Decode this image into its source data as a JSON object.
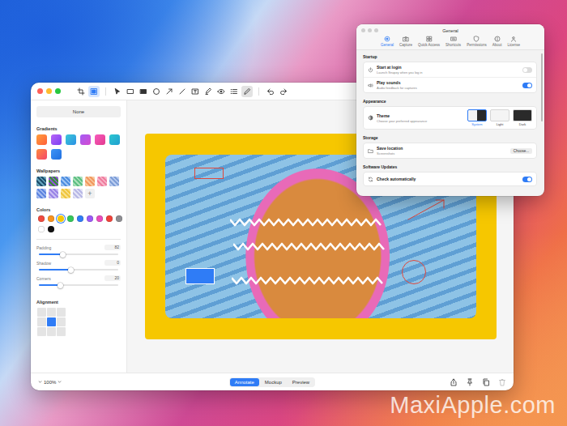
{
  "desktop": {
    "watermark": "MaxiApple.com"
  },
  "editor": {
    "toolbar": {
      "tools": [
        {
          "kind": "crop",
          "selected": false
        },
        {
          "kind": "background",
          "selected": true
        },
        {
          "kind": "select",
          "selected": false
        },
        {
          "kind": "rectangle",
          "selected": false
        },
        {
          "kind": "filled-rectangle",
          "selected": false
        },
        {
          "kind": "ellipse",
          "selected": false
        },
        {
          "kind": "arrow",
          "selected": false
        },
        {
          "kind": "line",
          "selected": false
        },
        {
          "kind": "text",
          "selected": false
        },
        {
          "kind": "highlighter",
          "selected": false
        },
        {
          "kind": "blur",
          "selected": false
        },
        {
          "kind": "list",
          "selected": false
        },
        {
          "kind": "pen",
          "selected": true
        }
      ],
      "history": [
        {
          "kind": "undo",
          "disabled": false
        },
        {
          "kind": "redo",
          "disabled": false
        }
      ]
    },
    "sidebar": {
      "none_button": "None",
      "gradients": {
        "title": "Gradients",
        "items": [
          {
            "color": "#ffa03c",
            "color_end": "#ff5e3a",
            "selected": false
          },
          {
            "color": "#b866f7",
            "color_end": "#7b3ff2",
            "selected": false
          },
          {
            "color": "#3cc9d6",
            "color_end": "#2a8fe6",
            "selected": false
          },
          {
            "color": "#a45cf5",
            "color_end": "#d54bd0",
            "selected": false
          },
          {
            "color": "#f75bbd",
            "color_end": "#e23a8e",
            "selected": false
          },
          {
            "color": "#2cc6d0",
            "color_end": "#1f9fd0",
            "selected": false
          },
          {
            "color": "#ff8a3d",
            "color_end": "#f4476b",
            "selected": false
          },
          {
            "color": "#3f95f7",
            "color_end": "#1f6fe0",
            "selected": false
          }
        ]
      },
      "wallpapers": {
        "title": "Wallpapers",
        "add": "+",
        "items": [
          {
            "color": "#1f4f6e",
            "color_end": "#5fa0b8",
            "selected": false
          },
          {
            "color": "#3d8c3a",
            "color_end": "#8a5ad0",
            "selected": false
          },
          {
            "color": "#4f8fe0",
            "color_end": "#9cc3f2",
            "selected": false
          },
          {
            "color": "#5fbf85",
            "color_end": "#a8e0b8",
            "selected": false
          },
          {
            "color": "#f29a62",
            "color_end": "#f7c79a",
            "selected": false
          },
          {
            "color": "#f07fa0",
            "color_end": "#f7b5c8",
            "selected": false
          },
          {
            "color": "#7f9fd8",
            "color_end": "#b9ccef",
            "selected": false
          },
          {
            "color": "#5f86e0",
            "color_end": "#a3bbf0",
            "selected": false
          },
          {
            "color": "#9a85e6",
            "color_end": "#c8bbf3",
            "selected": false
          },
          {
            "color": "#f0c640",
            "color_end": "#f7e08c",
            "selected": false
          },
          {
            "color": "#b9b9e6",
            "color_end": "#e2e2f5",
            "selected": false
          }
        ]
      },
      "colors": {
        "title": "Colors",
        "items": [
          {
            "color": "#f04a3e",
            "selected": false
          },
          {
            "color": "#f7931e",
            "selected": false
          },
          {
            "color": "#f6c700",
            "selected": true
          },
          {
            "color": "#34c759",
            "selected": false
          },
          {
            "color": "#2f7cf6",
            "selected": false
          },
          {
            "color": "#9b59f6",
            "selected": false
          },
          {
            "color": "#e94dbb",
            "selected": false
          },
          {
            "color": "#f0423a",
            "selected": false
          },
          {
            "color": "#8e8e93",
            "selected": false
          },
          {
            "color": "#ffffff",
            "selected": false
          },
          {
            "color": "#111111",
            "selected": false
          }
        ]
      },
      "sliders": [
        {
          "label": "Padding",
          "value": "82",
          "level": 0.3
        },
        {
          "label": "Shadow",
          "value": "0",
          "level": 0.4
        },
        {
          "label": "Corners",
          "value": "20",
          "level": 0.27
        }
      ],
      "alignment": {
        "title": "Alignment",
        "cells": [
          {
            "selected": false
          },
          {
            "selected": false
          },
          {
            "selected": false
          },
          {
            "selected": false
          },
          {
            "selected": true
          },
          {
            "selected": false
          },
          {
            "selected": false
          },
          {
            "selected": false
          },
          {
            "selected": false
          }
        ]
      }
    },
    "canvas": {
      "annotations": [
        {
          "kind": "rectangle",
          "color": "#e0463a"
        },
        {
          "kind": "zigzag",
          "color": "#ffffff"
        },
        {
          "kind": "zigzag",
          "color": "#ffffff"
        },
        {
          "kind": "zigzag",
          "color": "#ffffff"
        },
        {
          "kind": "filled-rectangle",
          "color": "#2f7cf6"
        },
        {
          "kind": "ellipse",
          "color": "#e0463a"
        },
        {
          "kind": "arrow",
          "color": "#e0463a"
        }
      ]
    },
    "bottom_bar": {
      "zoom": "100%",
      "modes": [
        {
          "label": "Annotate",
          "selected": true
        },
        {
          "label": "Mockup",
          "selected": false
        },
        {
          "label": "Preview",
          "selected": false
        }
      ],
      "actions": [
        {
          "kind": "share",
          "disabled": false
        },
        {
          "kind": "pin",
          "disabled": false
        },
        {
          "kind": "copy",
          "disabled": false
        },
        {
          "kind": "trash",
          "disabled": true
        }
      ]
    }
  },
  "settings": {
    "window": {
      "title": "General"
    },
    "tabs": [
      {
        "label": "General",
        "kind": "gear",
        "selected": true
      },
      {
        "label": "Capture",
        "kind": "camera",
        "selected": false
      },
      {
        "label": "Quick Access",
        "kind": "grid",
        "selected": false
      },
      {
        "label": "Shortcuts",
        "kind": "keyboard",
        "selected": false
      },
      {
        "label": "Permissions",
        "kind": "shield",
        "selected": false
      },
      {
        "label": "About",
        "kind": "info",
        "selected": false
      },
      {
        "label": "License",
        "kind": "person",
        "selected": false
      }
    ],
    "sections": [
      {
        "title": "Startup",
        "rows": [
          {
            "kind": "toggle",
            "label": "Start at login",
            "detail": "Launch Snapzy when you log in",
            "on": false
          },
          {
            "kind": "toggle",
            "label": "Play sounds",
            "detail": "Audio feedback for captures",
            "on": true
          }
        ]
      },
      {
        "title": "Appearance",
        "rows": [
          {
            "kind": "theme",
            "label": "Theme",
            "detail": "Choose your preferred appearance",
            "options": [
              {
                "label": "System",
                "selected": true
              },
              {
                "label": "Light",
                "selected": false
              },
              {
                "label": "Dark",
                "selected": false
              }
            ]
          }
        ]
      },
      {
        "title": "Storage",
        "rows": [
          {
            "kind": "button",
            "label": "Save location",
            "detail": "Screenshots",
            "button": "Choose..."
          }
        ]
      },
      {
        "title": "Software Updates",
        "rows": [
          {
            "kind": "toggle",
            "label": "Check automatically",
            "on": true
          }
        ]
      }
    ]
  }
}
